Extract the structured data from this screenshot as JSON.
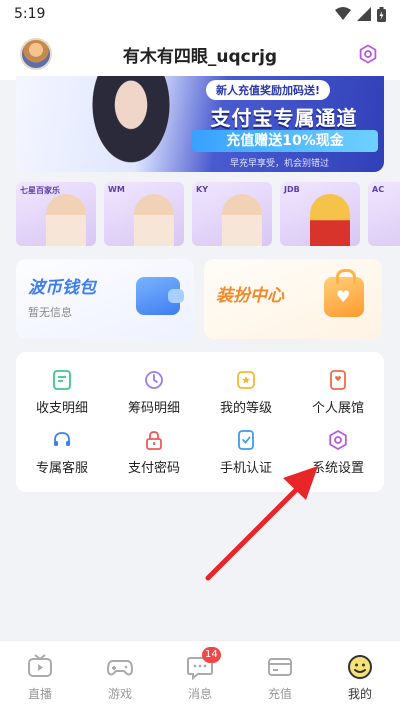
{
  "status_bar": {
    "time": "5:19"
  },
  "header": {
    "username": "有木有四眼_uqcrjg"
  },
  "banner": {
    "tag": "新人充值奖励加码送!",
    "title": "支付宝专属通道",
    "subtitle": "充值赠送10%现金",
    "footnote": "早充早享受，机会别错过"
  },
  "games": [
    {
      "name": "七星百家乐"
    },
    {
      "name": "WM"
    },
    {
      "name": "KY"
    },
    {
      "name": "JDB"
    },
    {
      "name": "AC"
    }
  ],
  "wallet": {
    "title": "波币钱包",
    "subtitle": "暂无信息"
  },
  "dress": {
    "title": "装扮中心"
  },
  "functions": [
    {
      "label": "收支明细",
      "icon": "receipt-icon",
      "color": "#3ec98a"
    },
    {
      "label": "筹码明细",
      "icon": "history-icon",
      "color": "#9b7cf0"
    },
    {
      "label": "我的等级",
      "icon": "level-star-icon",
      "color": "#f5b82e"
    },
    {
      "label": "个人展馆",
      "icon": "gallery-icon",
      "color": "#f06a4a"
    },
    {
      "label": "专属客服",
      "icon": "headset-icon",
      "color": "#3d7ef0"
    },
    {
      "label": "支付密码",
      "icon": "lock-icon",
      "color": "#f05a5a"
    },
    {
      "label": "手机认证",
      "icon": "phone-verify-icon",
      "color": "#3d9df0"
    },
    {
      "label": "系统设置",
      "icon": "settings-icon",
      "color": "#b85ae0"
    }
  ],
  "nav": [
    {
      "label": "直播",
      "icon": "tv-icon"
    },
    {
      "label": "游戏",
      "icon": "gamepad-icon"
    },
    {
      "label": "消息",
      "icon": "message-icon",
      "badge": "14"
    },
    {
      "label": "充值",
      "icon": "card-icon"
    },
    {
      "label": "我的",
      "icon": "smiley-icon",
      "active": true
    }
  ],
  "colors": {
    "accent": "#b85ae0",
    "arrow": "#e8262a",
    "badge": "#f04848"
  }
}
